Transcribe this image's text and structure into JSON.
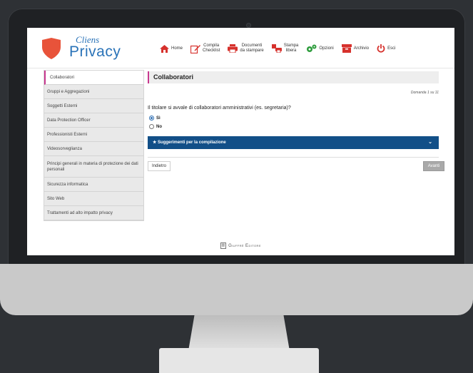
{
  "brand": {
    "line1": "Cliens",
    "line2": "Privacy",
    "color": "#2a73b8",
    "shield_color": "#e8533a"
  },
  "nav": [
    {
      "label1": "Home",
      "label2": "",
      "icon": "home-icon"
    },
    {
      "label1": "Compila",
      "label2": "Checklist",
      "icon": "checklist-edit-icon"
    },
    {
      "label1": "Documenti",
      "label2": "da stampare",
      "icon": "printer-icon"
    },
    {
      "label1": "Stampa",
      "label2": "libera",
      "icon": "print-free-icon"
    },
    {
      "label1": "Opzioni",
      "label2": "",
      "icon": "gears-icon"
    },
    {
      "label1": "Archivio",
      "label2": "",
      "icon": "archive-icon"
    },
    {
      "label1": "Esci",
      "label2": "",
      "icon": "power-icon"
    }
  ],
  "sidebar": {
    "items": [
      "Collaboratori",
      "Gruppi e Aggregazioni",
      "Soggetti Esterni",
      "Data Protection Officer",
      "Professionisti Esterni",
      "Videosorveglianza",
      "Principi generali in materia di protezione dei dati personali",
      "Sicurezza informatica",
      "Sito Web",
      "Trattamenti ad alto impatto privacy"
    ]
  },
  "main": {
    "title": "Collaboratori",
    "counter": "Domanda 1 su 11",
    "question": "Il titolare si avvale di collaboratori amministrativi (es. segretaria)?",
    "options": [
      {
        "label": "Sì",
        "selected": true
      },
      {
        "label": "No",
        "selected": false
      }
    ],
    "tips_label": "★ Suggerimenti per la compilazione",
    "back_label": "Indietro",
    "next_label": "Avanti"
  },
  "footer": {
    "text": "Giuffrè Editore"
  },
  "colors": {
    "accent": "#c8388f",
    "tips_bar": "#124f88",
    "nav_icon_green": "#2d9c3c",
    "nav_icon_red": "#d6312c"
  }
}
